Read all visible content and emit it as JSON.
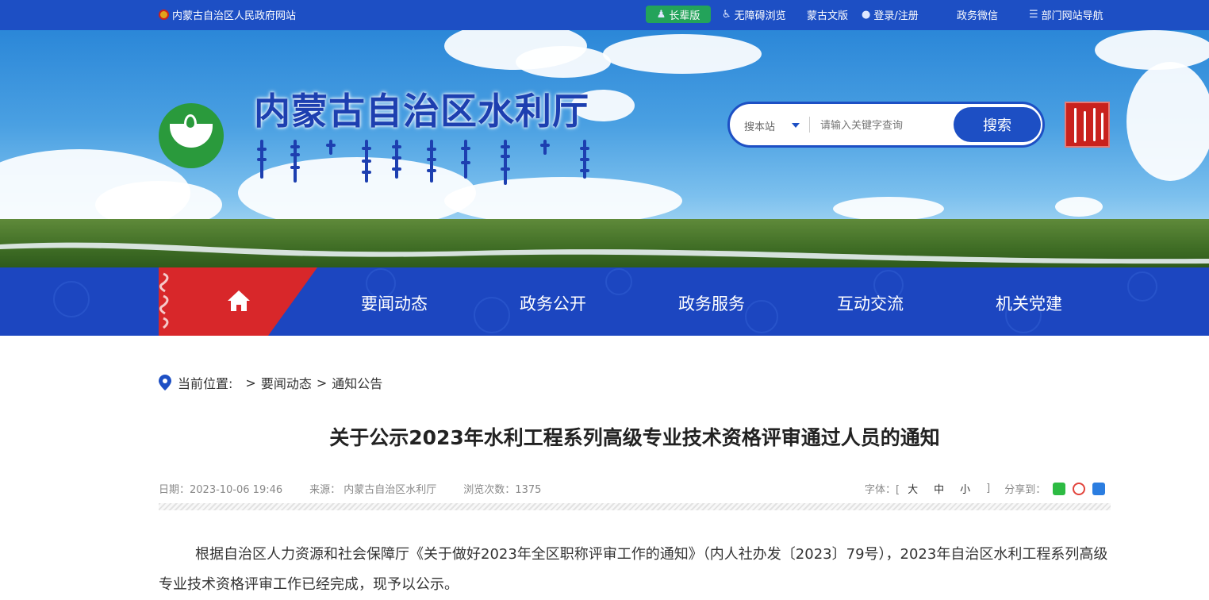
{
  "topbar": {
    "site_name": "内蒙古自治区人民政府网站",
    "elder_mode": "长辈版",
    "accessible": "无障碍浏览",
    "mongolian": "蒙古文版",
    "login": "登录/注册",
    "wechat": "政务微信",
    "dept_nav": "部门网站导航"
  },
  "header": {
    "title": "内蒙古自治区水利厅",
    "search": {
      "scope": "搜本站",
      "placeholder": "请输入关键字查询",
      "button": "搜索"
    }
  },
  "nav": {
    "items": [
      "要闻动态",
      "政务公开",
      "政务服务",
      "互动交流",
      "机关党建"
    ]
  },
  "breadcrumb": {
    "label": "当前位置:",
    "items": [
      "要闻动态",
      "通知公告"
    ]
  },
  "article": {
    "title": "关于公示2023年水利工程系列高级专业技术资格评审通过人员的通知",
    "date": "日期：2023-10-06 19:46",
    "source": "来源： 内蒙古自治区水利厅",
    "views": "浏览次数：1375",
    "font_label": "字体：[",
    "font_large": "大",
    "font_medium": "中",
    "font_small": "小",
    "font_close": "]",
    "share_label": "分享到：",
    "body": "根据自治区人力资源和社会保障厅《关于做好2023年全区职称评审工作的通知》（内人社办发〔2023〕79号），2023年自治区水利工程系列高级专业技术资格评审工作已经完成，现予以公示。"
  },
  "colors": {
    "primary_blue": "#1d4fc4",
    "nav_blue": "#1c46c0",
    "home_red": "#d8272a",
    "elder_green": "#23a35a"
  }
}
